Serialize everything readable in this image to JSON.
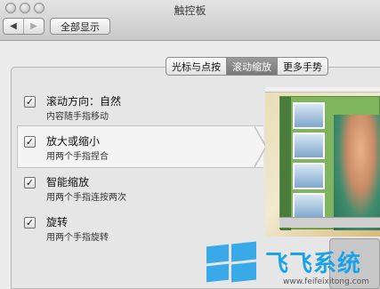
{
  "window": {
    "title": "触控板"
  },
  "toolbar": {
    "back": "◀",
    "forward": "▶",
    "show_all": "全部显示"
  },
  "tabs": [
    {
      "label": "光标与点按",
      "active": false
    },
    {
      "label": "滚动缩放",
      "active": true
    },
    {
      "label": "更多手势",
      "active": false
    }
  ],
  "options": [
    {
      "title": "滚动方向：自然",
      "desc": "内容随手指移动",
      "checked": true
    },
    {
      "title": "放大或缩小",
      "desc": "用两个手指捏合",
      "checked": true
    },
    {
      "title": "智能缩放",
      "desc": "用两个手指连按两次",
      "checked": true
    },
    {
      "title": "旋转",
      "desc": "用两个手指旋转",
      "checked": true
    }
  ],
  "watermark": {
    "text": "飞飞系统",
    "url": "www.feifeixitong.com"
  },
  "icons": {
    "check": "✓",
    "windows_logo": "windows-logo"
  },
  "colors": {
    "active_tab": "#888888",
    "watermark": "#1aa3e8"
  }
}
